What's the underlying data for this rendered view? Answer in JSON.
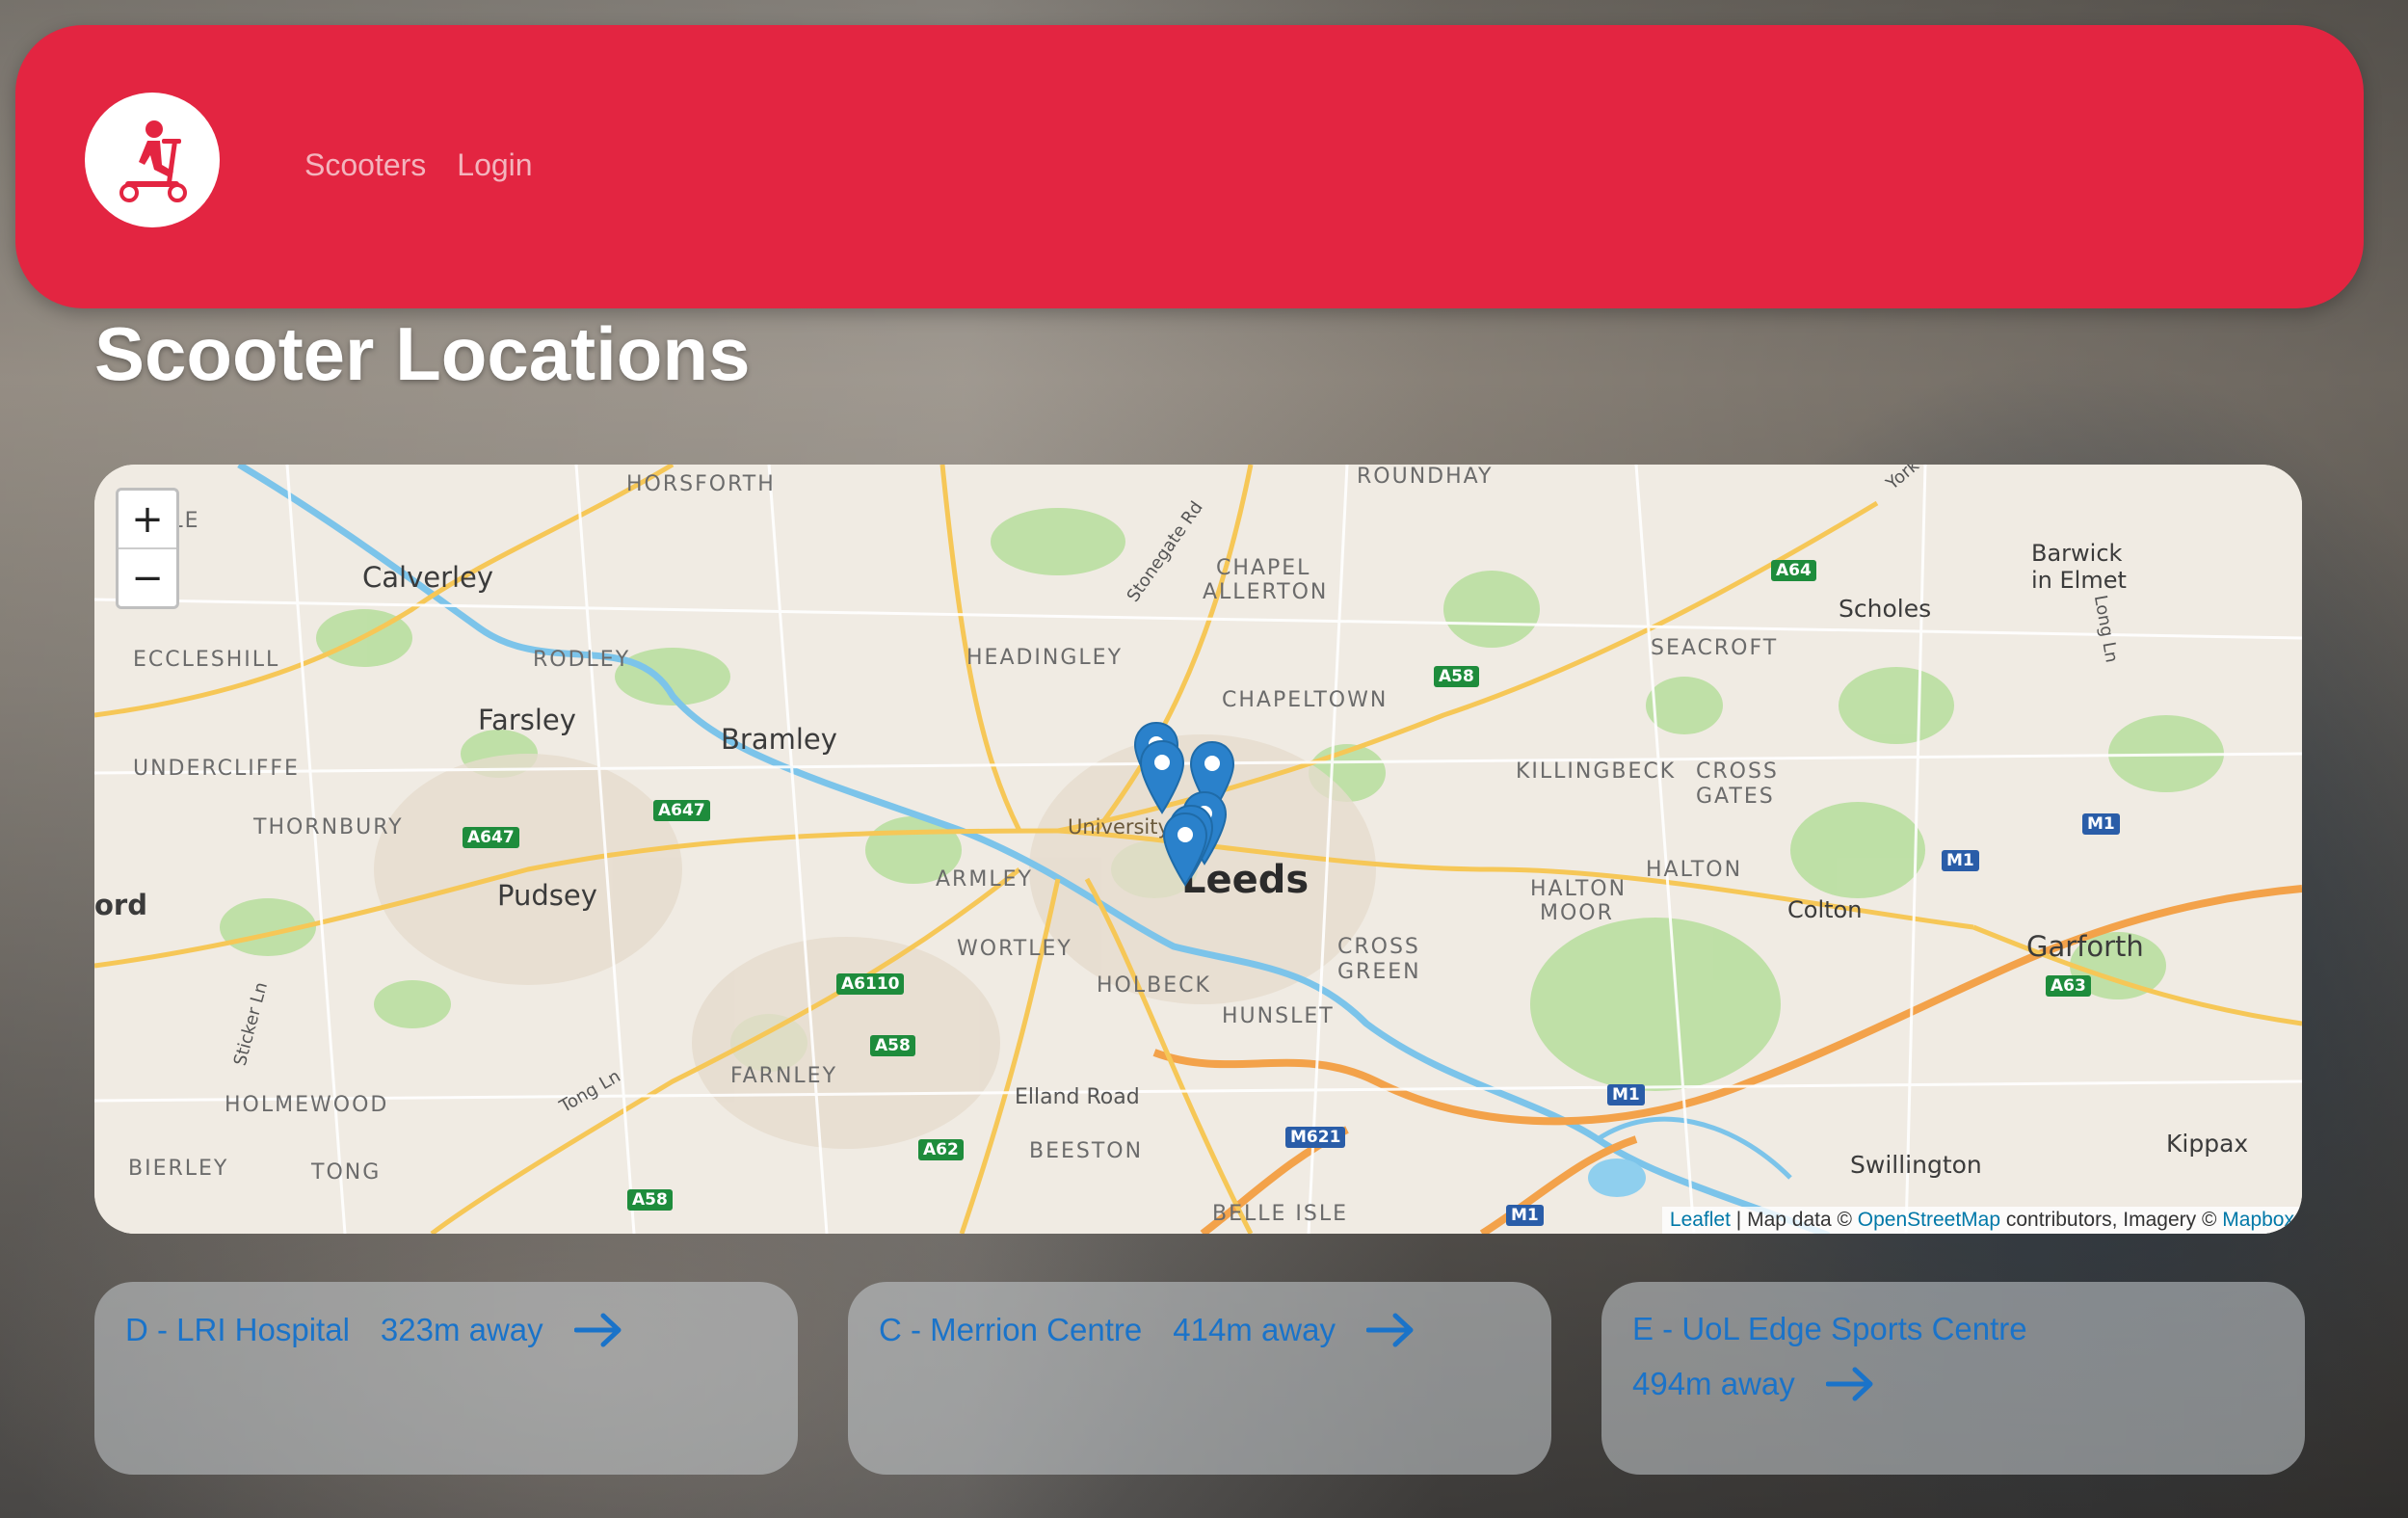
{
  "nav": {
    "logo_alt": "scooter-logo",
    "links": [
      {
        "label": "Scooters"
      },
      {
        "label": "Login"
      }
    ]
  },
  "page": {
    "title": "Scooter Locations"
  },
  "map": {
    "zoom_in": "+",
    "zoom_out": "−",
    "attribution": {
      "leaflet": "Leaflet",
      "sep1": " | Map data © ",
      "osm": "OpenStreetMap",
      "sep2": " contributors, Imagery © ",
      "mapbox": "Mapbox"
    },
    "labels": {
      "horsforth": "HORSFORTH",
      "roundhay": "ROUNDHAY",
      "calverley": "Calverley",
      "chapel_allerton_1": "CHAPEL",
      "chapel_allerton_2": "ALLERTON",
      "barwick_1": "Barwick",
      "barwick_2": "in Elmet",
      "scholes": "Scholes",
      "eccleshill": "ECCLESHILL",
      "rodley": "RODLEY",
      "headingley": "HEADINGLEY",
      "seacroft": "SEACROFT",
      "chapeltown": "CHAPELTOWN",
      "farsley": "Farsley",
      "bramley": "Bramley",
      "undercliffe": "UNDERCLIFFE",
      "killingbeck": "KILLINGBECK",
      "cross_gates_1": "CROSS",
      "cross_gates_2": "GATES",
      "thornbury": "THORNBURY",
      "university": "University of L",
      "leeds": "Leeds",
      "armley": "ARMLEY",
      "halton_moor_1": "HALTON",
      "halton_moor_2": "MOOR",
      "halton": "HALTON",
      "colton": "Colton",
      "pudsey": "Pudsey",
      "wortley": "WORTLEY",
      "cross_green_1": "CROSS",
      "cross_green_2": "GREEN",
      "garforth": "Garforth",
      "holbeck": "HOLBECK",
      "hunslet": "HUNSLET",
      "farnley": "FARNLEY",
      "holmewood": "HOLMEWOOD",
      "elland_road": "Elland Road",
      "beeston": "BEESTON",
      "bierley": "BIERLEY",
      "tong": "TONG",
      "swillington": "Swillington",
      "kippax": "Kippax",
      "belle_isle": "BELLE ISLE",
      "ford": "ord",
      "stonegate_rd": "Stonegate Rd",
      "tong_ln": "Tong Ln",
      "sticker_ln": "Sticker Ln",
      "long_ln": "Long Ln",
      "york": "York",
      "ole": "OLE"
    },
    "roads": {
      "a64": "A64",
      "a58": "A58",
      "a647a": "A647",
      "a647b": "A647",
      "a6110": "A6110",
      "a58b": "A58",
      "a62": "A62",
      "a58c": "A58",
      "a63": "A63",
      "m1a": "M1",
      "m1b": "M1",
      "m1c": "M1",
      "m1d": "M1",
      "m621": "M621"
    },
    "marker_count": 6
  },
  "cards": [
    {
      "name": "D - LRI Hospital",
      "distance": "323m away"
    },
    {
      "name": "C - Merrion Centre",
      "distance": "414m away"
    },
    {
      "name": "E - UoL Edge Sports Centre",
      "distance": "494m away"
    }
  ],
  "colors": {
    "nav_bg": "#e32541",
    "nav_link": "#f3b4bd",
    "card_text": "#1a73c9",
    "marker": "#2a81cb"
  }
}
